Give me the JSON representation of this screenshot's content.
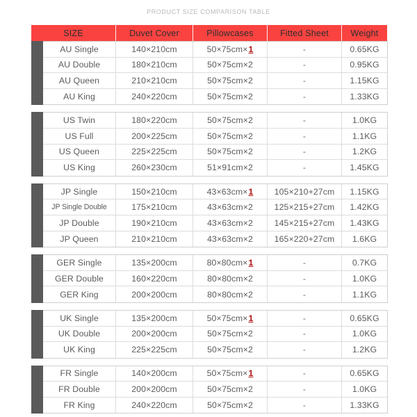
{
  "page": {
    "title": "PRODUCT SIZE COMPARISON TABLE",
    "accent_color": "#fa4340",
    "tab_color": "#5a5a5a",
    "highlight_color": "#b01212",
    "background": "#ffffff"
  },
  "table": {
    "columns": [
      {
        "key": "size",
        "label": "SIZE"
      },
      {
        "key": "duvet",
        "label": "Duvet  Cover"
      },
      {
        "key": "pillow",
        "label": "Pillowcases"
      },
      {
        "key": "fitted",
        "label": "Fitted Sheet"
      },
      {
        "key": "weight",
        "label": "Weight"
      }
    ],
    "groups": [
      {
        "region": "AU",
        "rows": [
          {
            "size": "AU Single",
            "duvet": "140×210cm",
            "pillow_base": "50×75cm×",
            "pillow_qty": "1",
            "pillow_highlight": true,
            "fitted": "-",
            "weight": "0.65KG"
          },
          {
            "size": "AU Double",
            "duvet": "180×210cm",
            "pillow_base": "50×75cm×",
            "pillow_qty": "2",
            "pillow_highlight": false,
            "fitted": "-",
            "weight": "0.95KG"
          },
          {
            "size": "AU Queen",
            "duvet": "210×210cm",
            "pillow_base": "50×75cm×",
            "pillow_qty": "2",
            "pillow_highlight": false,
            "fitted": "-",
            "weight": "1.15KG"
          },
          {
            "size": "AU  King",
            "duvet": "240×220cm",
            "pillow_base": "50×75cm×",
            "pillow_qty": "2",
            "pillow_highlight": false,
            "fitted": "-",
            "weight": "1.33KG"
          }
        ]
      },
      {
        "region": "US",
        "rows": [
          {
            "size": "US Twin",
            "duvet": "180×220cm",
            "pillow_base": "50×75cm×",
            "pillow_qty": "2",
            "pillow_highlight": false,
            "fitted": "-",
            "weight": "1.0KG"
          },
          {
            "size": "US Full",
            "duvet": "200×225cm",
            "pillow_base": "50×75cm×",
            "pillow_qty": "2",
            "pillow_highlight": false,
            "fitted": "-",
            "weight": "1.1KG"
          },
          {
            "size": "US Queen",
            "duvet": "225×225cm",
            "pillow_base": "50×75cm×",
            "pillow_qty": "2",
            "pillow_highlight": false,
            "fitted": "-",
            "weight": "1.2KG"
          },
          {
            "size": "US King",
            "duvet": "260×230cm",
            "pillow_base": "51×91cm×",
            "pillow_qty": "2",
            "pillow_highlight": false,
            "fitted": "-",
            "weight": "1.45KG"
          }
        ]
      },
      {
        "region": "JP",
        "rows": [
          {
            "size": "JP Single",
            "duvet": "150×210cm",
            "pillow_base": "43×63cm×",
            "pillow_qty": "1",
            "pillow_highlight": true,
            "fitted": "105×210+27cm",
            "weight": "1.15KG"
          },
          {
            "size": "JP Single Double",
            "duvet": "175×210cm",
            "pillow_base": "43×63cm×",
            "pillow_qty": "2",
            "pillow_highlight": false,
            "fitted": "125×215+27cm",
            "weight": "1.42KG",
            "condensed": true
          },
          {
            "size": "JP Double",
            "duvet": "190×210cm",
            "pillow_base": "43×63cm×",
            "pillow_qty": "2",
            "pillow_highlight": false,
            "fitted": "145×215+27cm",
            "weight": "1.43KG"
          },
          {
            "size": "JP Queen",
            "duvet": "210×210cm",
            "pillow_base": "43×63cm×",
            "pillow_qty": "2",
            "pillow_highlight": false,
            "fitted": "165×220+27cm",
            "weight": "1.6KG"
          }
        ]
      },
      {
        "region": "GER",
        "rows": [
          {
            "size": "GER Single",
            "duvet": "135×200cm",
            "pillow_base": "80×80cm×",
            "pillow_qty": "1",
            "pillow_highlight": true,
            "fitted": "-",
            "weight": "0.7KG"
          },
          {
            "size": "GER Double",
            "duvet": "160×220cm",
            "pillow_base": "80×80cm×",
            "pillow_qty": "2",
            "pillow_highlight": false,
            "fitted": "-",
            "weight": "1.0KG"
          },
          {
            "size": "GER King",
            "duvet": "200×200cm",
            "pillow_base": "80×80cm×",
            "pillow_qty": "2",
            "pillow_highlight": false,
            "fitted": "-",
            "weight": "1.1KG"
          }
        ]
      },
      {
        "region": "UK",
        "rows": [
          {
            "size": "UK Single",
            "duvet": "135×200cm",
            "pillow_base": "50×75cm×",
            "pillow_qty": "1",
            "pillow_highlight": true,
            "fitted": "-",
            "weight": "0.65KG"
          },
          {
            "size": "UK Double",
            "duvet": "200×200cm",
            "pillow_base": "50×75cm×",
            "pillow_qty": "2",
            "pillow_highlight": false,
            "fitted": "-",
            "weight": "1.0KG"
          },
          {
            "size": "UK King",
            "duvet": "225×225cm",
            "pillow_base": "50×75cm×",
            "pillow_qty": "2",
            "pillow_highlight": false,
            "fitted": "-",
            "weight": "1.2KG"
          }
        ]
      },
      {
        "region": "FR",
        "rows": [
          {
            "size": "FR Single",
            "duvet": "140×200cm",
            "pillow_base": "50×75cm×",
            "pillow_qty": "1",
            "pillow_highlight": true,
            "fitted": "-",
            "weight": "0.65KG"
          },
          {
            "size": "FR Double",
            "duvet": "200×200cm",
            "pillow_base": "50×75cm×",
            "pillow_qty": "2",
            "pillow_highlight": false,
            "fitted": "-",
            "weight": "1.0KG"
          },
          {
            "size": "FR King",
            "duvet": "240×220cm",
            "pillow_base": "50×75cm×",
            "pillow_qty": "2",
            "pillow_highlight": false,
            "fitted": "-",
            "weight": "1.33KG"
          }
        ]
      }
    ]
  }
}
